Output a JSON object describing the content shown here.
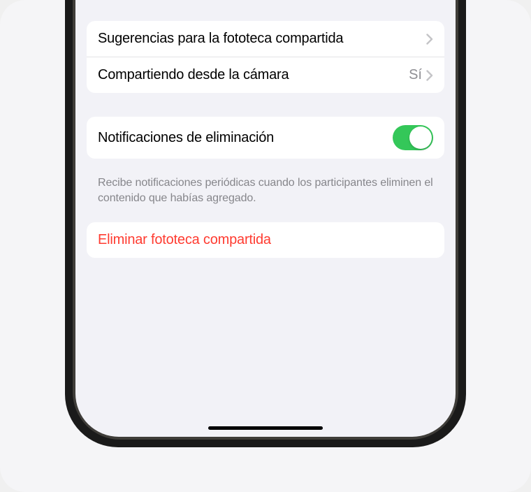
{
  "group1": {
    "row1": {
      "label": "Sugerencias para la fototeca compartida"
    },
    "row2": {
      "label": "Compartiendo desde la cámara",
      "value": "Sí"
    }
  },
  "group2": {
    "toggle": {
      "label": "Notificaciones de eliminación",
      "on": true
    },
    "footer": "Recibe notificaciones periódicas cuando los participantes eliminen el contenido que habías agregado."
  },
  "group3": {
    "destructive_label": "Eliminar fototeca compartida"
  },
  "colors": {
    "toggle_on": "#34c759",
    "destructive": "#ff3b30",
    "screen_bg": "#f2f2f7"
  }
}
